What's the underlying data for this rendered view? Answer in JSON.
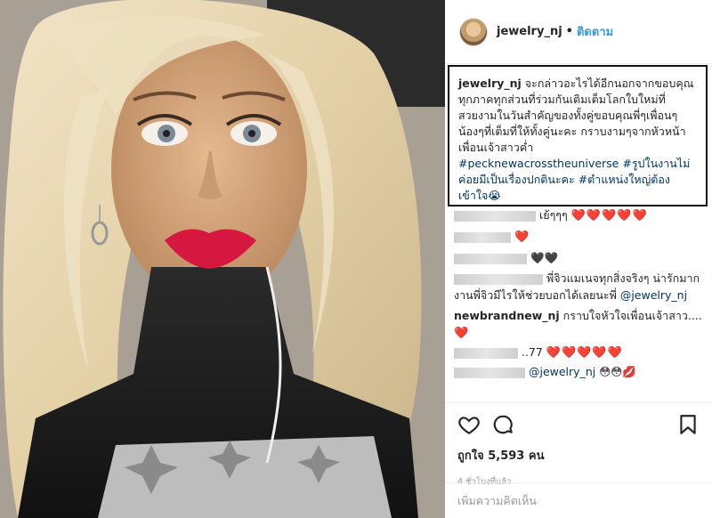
{
  "header": {
    "username": "jewelry_nj",
    "separator": "•",
    "follow_label": "ติดตาม"
  },
  "caption": {
    "username": "jewelry_nj",
    "text": " จะกล่าวอะไรได้อีกนอกจากขอบคุณทุกภาคทุกส่วนที่ร่วมกันเติมเต็มโลกใบใหม่ที่สวยงามในวันสำคัญของทั้งคู่ขอบคุณพี่ๆเพื่อนๆน้องๆที่เต็มที่ให้ทั้งคู่นะคะ กราบงามๆจากหัวหน้าเพื่อนเจ้าสาวค่ำ ",
    "tags": "#pecknewacrosstheuniverse #รูปในงานไม่ค่อยมีเป็นเรื่องปกตินะคะ #ตำแหน่งใหญ่ต้องเข้าใจ😭"
  },
  "comments": [
    {
      "text": "เย้ๆๆๆ",
      "hearts": "❤️❤️❤️❤️❤️"
    },
    {
      "text": "",
      "hearts": "❤️"
    },
    {
      "text": "",
      "hearts": "🖤🖤"
    },
    {
      "text": "พี่จิวแมเนจทุกสิ่งจริงๆ น่ารักมากงานพี่จิวมีไรให้ช่วยบอกได้เลยนะพี่",
      "mention": "@jewelry_nj"
    },
    {
      "user": "newbrandnew_nj",
      "text": " กราบใจหัวใจเพื่อนเจ้าสาว.... ",
      "hearts": "❤️"
    },
    {
      "text": "..77",
      "hearts": "❤️❤️❤️❤️❤️"
    },
    {
      "mention": "@jewelry_nj",
      "emoji": "😳😳💋"
    }
  ],
  "actions": {
    "likes": "ถูกใจ 5,593 คน",
    "time": "4 ชั่วโมงที่แล้ว"
  },
  "add_comment": {
    "placeholder": "เพิ่มความคิดเห็น"
  },
  "icons": [
    "heart-icon",
    "comment-icon",
    "bookmark-icon"
  ]
}
